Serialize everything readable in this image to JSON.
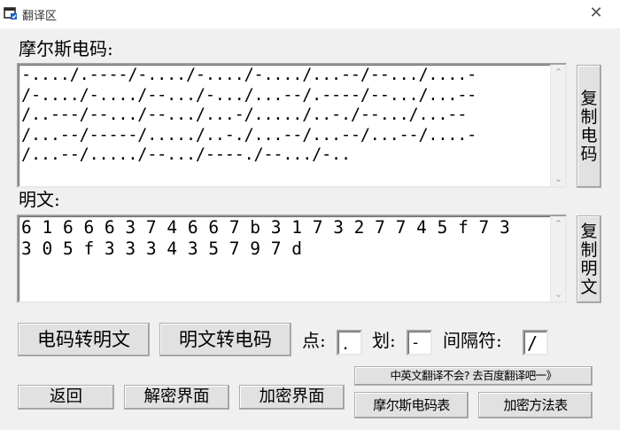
{
  "window": {
    "title": "翻译区",
    "close_glyph": "✕"
  },
  "morse_section": {
    "label": "摩尔斯电码:",
    "lines": [
      "-..../.----/-..../-..../-..../...--/--.../....-",
      "/-..../-..../--.../-.../...--/.----/--.../...--",
      "/..---/--.../--.../...-/...../..-./--.../...--",
      "/...--/-----/...../..-./...--/...--/...--/....-",
      "/...--/...../--.../----./--.../-.."
    ],
    "copy_button": [
      "复",
      "制",
      "电",
      "码"
    ]
  },
  "plain_section": {
    "label": "明文:",
    "lines": [
      "6 1 6 6 6 3 7 4 6 6 7 b 3 1 7 3 2 7 7 4 5 f 7 3",
      "3 0 5 f 3 3 3 4 3 5 7 9 7 d"
    ],
    "copy_button": [
      "复",
      "制",
      "明",
      "文"
    ]
  },
  "scroll": {
    "up_glyph": "⌃",
    "down_glyph": "⌄"
  },
  "controls": {
    "morse_to_plain": "电码转明文",
    "plain_to_morse": "明文转电码",
    "dot_label": "点:",
    "dot_value": ".",
    "dash_label": "划:",
    "dash_value": "-",
    "separator_label": "间隔符:",
    "separator_value": "/"
  },
  "bottom": {
    "back": "返回",
    "decrypt": "解密界面",
    "encrypt": "加密界面",
    "baidu": "中英文翻译不会? 去百度翻译吧一》",
    "morse_table": "摩尔斯电码表",
    "encrypt_methods": "加密方法表"
  }
}
